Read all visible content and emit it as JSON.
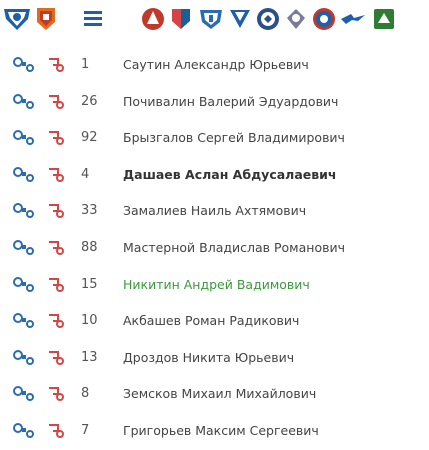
{
  "header": {
    "team_logos": [
      "club-logo-1",
      "club-logo-2",
      "club-logo-3",
      "club-logo-4",
      "club-logo-5",
      "club-logo-6",
      "club-logo-7",
      "club-logo-8",
      "club-logo-9",
      "club-logo-10",
      "club-logo-11"
    ]
  },
  "players": [
    {
      "number": "1",
      "name": "Саутин Александр Юрьевич",
      "style": "normal"
    },
    {
      "number": "26",
      "name": "Почивалин Валерий Эдуардович",
      "style": "normal"
    },
    {
      "number": "92",
      "name": "Брызгалов Сергей Владимирович",
      "style": "normal"
    },
    {
      "number": "4",
      "name": "Дашаев Аслан Абдусалаевич",
      "style": "bold"
    },
    {
      "number": "33",
      "name": "Замалиев Наиль Ахтямович",
      "style": "normal"
    },
    {
      "number": "88",
      "name": "Мастерной Владислав Романович",
      "style": "normal"
    },
    {
      "number": "15",
      "name": "Никитин Андрей Вадимович",
      "style": "green"
    },
    {
      "number": "10",
      "name": "Акбашев Роман Радикович",
      "style": "normal"
    },
    {
      "number": "13",
      "name": "Дроздов Никита Юрьевич",
      "style": "normal"
    },
    {
      "number": "8",
      "name": "Земсков Михаил Михайлович",
      "style": "normal"
    },
    {
      "number": "7",
      "name": "Григорьев Максим Сергеевич",
      "style": "normal"
    }
  ],
  "colors": {
    "blue": "#2b6cb0",
    "red": "#d64545",
    "green": "#3a9a3a"
  }
}
